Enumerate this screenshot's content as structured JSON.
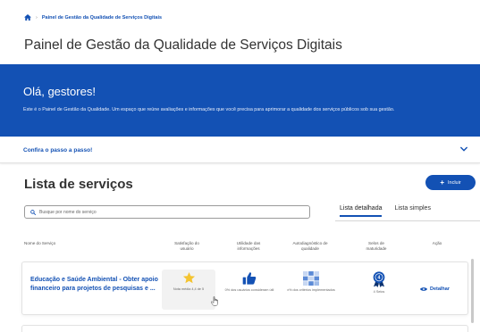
{
  "breadcrumb": {
    "current": "Painel de Gestão da Qualidade de Serviços Digitais"
  },
  "page": {
    "title": "Painel de Gestão da Qualidade de Serviços Digitais"
  },
  "banner": {
    "greeting": "Olá, gestores!",
    "description": "Este é o Painel de Gestão da Qualidade. Um espaço que reúne avaliações e informações que você precisa para aprimorar a qualidade dos serviços públicos sob sua gestão."
  },
  "steps": {
    "label": "Confira o passo a passo!"
  },
  "list": {
    "title": "Lista de serviços",
    "add_label": "Incluir",
    "search_placeholder": "Busque por nome do serviço",
    "tabs": [
      "Lista detalhada",
      "Lista simples"
    ],
    "active_tab": "Lista detalhada",
    "columns": {
      "name": "Nome do Serviço",
      "satisfaction": "Satisfação do usuário",
      "utility": "Utilidade das informações",
      "self_diagnosis": "Autodiagnóstico de qualidade",
      "maturity": "Selos de maturidade",
      "action": "Ação"
    },
    "rows": [
      {
        "name": "Educação e Saúde Ambiental - Obter apoio financeiro para projetos de pesquisas e ...",
        "satisfaction": "Nota média 4,4 de 5",
        "utility": "0% dos usuários consideram útil",
        "self_diagnosis": "x% dos critérios implementados",
        "maturity_level": "4",
        "maturity": "4 Selos",
        "action": "Detalhar"
      }
    ]
  },
  "colors": {
    "brand": "#1351b4",
    "star": "#f4c431",
    "text": "#333333"
  },
  "icons": {
    "home": "home-icon",
    "chevron": "chevron-down-icon",
    "search": "search-icon",
    "star": "star-icon",
    "thumbs_up": "thumbs-up-icon",
    "grid": "grid-icon",
    "medal": "medal-icon",
    "eye": "eye-icon",
    "plus": "plus-icon"
  }
}
